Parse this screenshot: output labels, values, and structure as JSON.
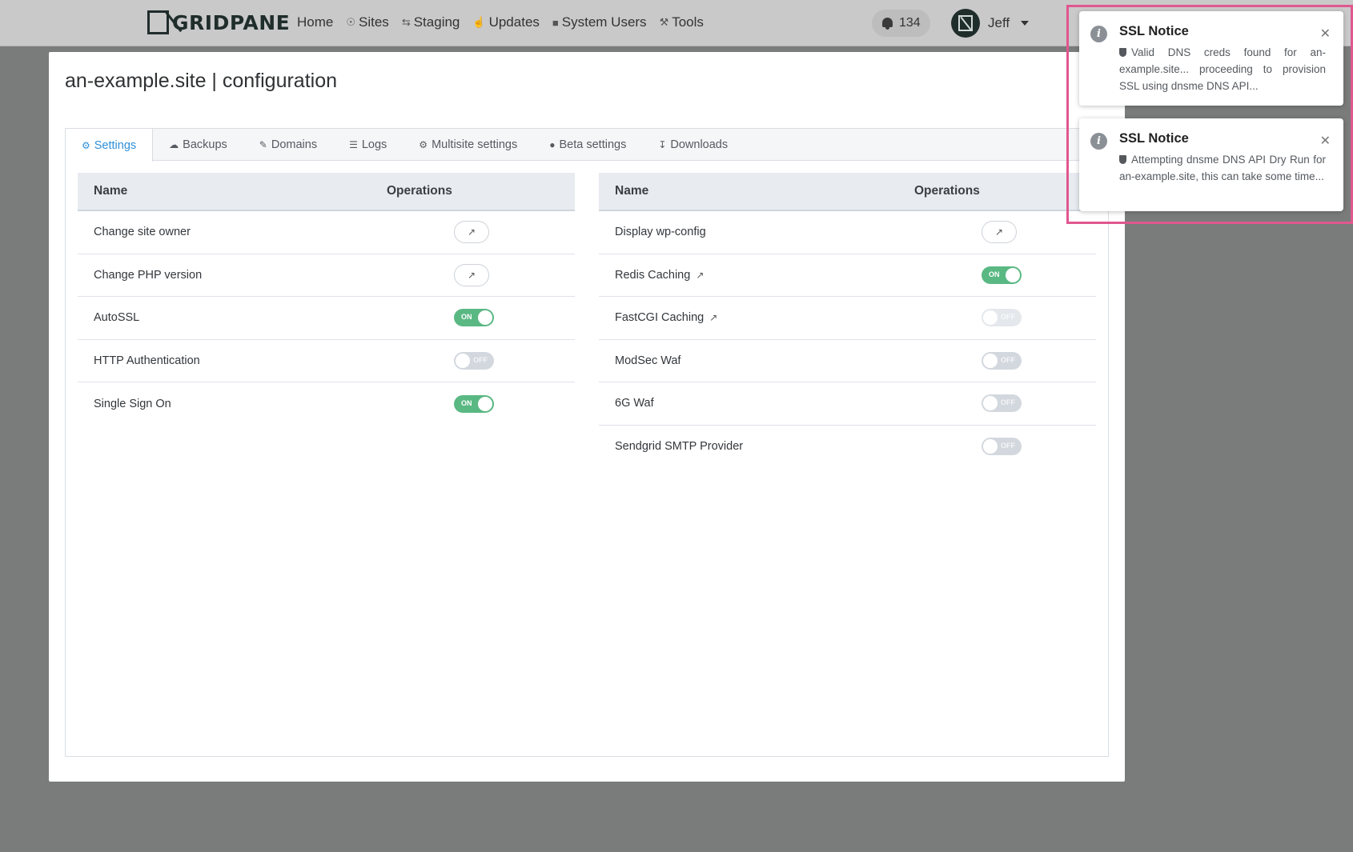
{
  "nav": {
    "logo_text": "GRIDPANE",
    "links": [
      {
        "label": "Home",
        "icon": ""
      },
      {
        "label": "Sites",
        "icon": "wordpress-icon"
      },
      {
        "label": "Staging",
        "icon": "swap-icon"
      },
      {
        "label": "Updates",
        "icon": "thumbs-up-icon"
      },
      {
        "label": "System Users",
        "icon": "user-lock-icon"
      },
      {
        "label": "Tools",
        "icon": "wrench-icon"
      }
    ],
    "notifications_count": "134",
    "user_name": "Jeff"
  },
  "page": {
    "title": "an-example.site | configuration"
  },
  "tabs": [
    {
      "label": "Settings",
      "icon": "gear-icon",
      "active": true
    },
    {
      "label": "Backups",
      "icon": "cloud-icon"
    },
    {
      "label": "Domains",
      "icon": "edit-icon"
    },
    {
      "label": "Logs",
      "icon": "file-icon"
    },
    {
      "label": "Multisite settings",
      "icon": "gear-icon"
    },
    {
      "label": "Beta settings",
      "icon": "exclamation-icon"
    },
    {
      "label": "Downloads",
      "icon": "download-icon"
    }
  ],
  "left_table": {
    "col_name": "Name",
    "col_ops": "Operations",
    "rows": [
      {
        "name": "Change site owner",
        "op": "external-link"
      },
      {
        "name": "Change PHP version",
        "op": "external-link"
      },
      {
        "name": "AutoSSL",
        "op": "toggle",
        "state": "ON"
      },
      {
        "name": "HTTP Authentication",
        "op": "toggle",
        "state": "OFF"
      },
      {
        "name": "Single Sign On",
        "op": "toggle",
        "state": "ON"
      }
    ]
  },
  "right_table": {
    "col_name": "Name",
    "col_ops": "Operations",
    "rows": [
      {
        "name": "Display wp-config",
        "op": "external-link"
      },
      {
        "name": "Redis Caching",
        "op": "toggle",
        "state": "ON",
        "link": true
      },
      {
        "name": "FastCGI Caching",
        "op": "toggle",
        "state": "OFF",
        "link": true
      },
      {
        "name": "ModSec Waf",
        "op": "toggle",
        "state": "OFF"
      },
      {
        "name": "6G Waf",
        "op": "toggle",
        "state": "OFF"
      },
      {
        "name": "Sendgrid SMTP Provider",
        "op": "toggle",
        "state": "OFF"
      }
    ]
  },
  "notices": [
    {
      "title": "SSL Notice",
      "message": "Valid DNS creds found for an-example.site... proceeding to provision SSL using dnsme DNS API..."
    },
    {
      "title": "SSL Notice",
      "message": "Attempting dnsme DNS API Dry Run for an-example.site, this can take some time..."
    }
  ],
  "colors": {
    "toggle_on": "#5ab883",
    "toggle_off": "#d3d8de",
    "active_tab": "#2f8fd8",
    "highlight_frame": "#e0578f"
  }
}
